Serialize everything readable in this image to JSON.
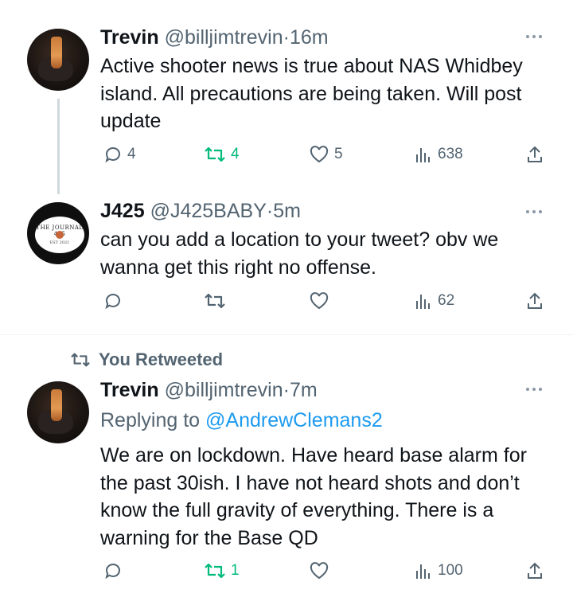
{
  "tweets": [
    {
      "name": "Trevin",
      "handle": "@billjimtrevin",
      "dot": "·",
      "time": "16m",
      "text": "Active shooter news is true about NAS Whidbey island. All precautions are being taken. Will post update",
      "replies": "4",
      "retweets": "4",
      "likes": "5",
      "views": "638",
      "retweeted": true,
      "avatar": "orange-drink-bottle-photo"
    },
    {
      "name": "J425",
      "handle": "@J425BABY",
      "dot": "·",
      "time": "5m",
      "text": "can you add a location to your tweet? obv we wanna get this right no offense.",
      "replies": "",
      "retweets": "",
      "likes": "",
      "views": "62",
      "retweeted": false,
      "avatar": "the-journal-425-logo",
      "avatar_text": "THE JOURNAL 425",
      "avatar_sub": "EST 2021"
    },
    {
      "social_context": "You Retweeted",
      "name": "Trevin",
      "handle": "@billjimtrevin",
      "dot": "·",
      "time": "7m",
      "replying_prefix": "Replying to ",
      "replying_to": "@AndrewClemans2",
      "text": "We are on lockdown. Have heard base alarm for the past 30ish. I have not heard shots and don’t know the full gravity of everything. There is a warning for the Base QD",
      "replies": "",
      "retweets": "1",
      "likes": "",
      "views": "100",
      "retweeted": true,
      "avatar": "orange-drink-bottle-photo"
    }
  ],
  "colors": {
    "text": "#0f1419",
    "muted": "#536471",
    "link": "#1d9bf0",
    "retweet_active": "#00ba7c",
    "thread_line": "#cfd9de"
  }
}
